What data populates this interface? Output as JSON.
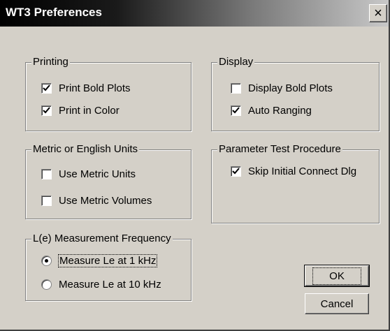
{
  "window": {
    "title": "WT3 Preferences",
    "close_glyph": "×"
  },
  "printing": {
    "legend": "Printing",
    "items": [
      {
        "label": "Print Bold Plots",
        "checked": true
      },
      {
        "label": "Print in Color",
        "checked": true
      }
    ]
  },
  "display": {
    "legend": "Display",
    "items": [
      {
        "label": "Display Bold Plots",
        "checked": false
      },
      {
        "label": "Auto Ranging",
        "checked": true
      }
    ]
  },
  "units": {
    "legend": "Metric or English Units",
    "items": [
      {
        "label": "Use Metric Units",
        "checked": false
      },
      {
        "label": "Use Metric Volumes",
        "checked": false
      }
    ]
  },
  "param_test": {
    "legend": "Parameter Test Procedure",
    "items": [
      {
        "label": "Skip Initial Connect Dlg",
        "checked": true
      }
    ]
  },
  "le_freq": {
    "legend": "L(e) Measurement Frequency",
    "options": [
      {
        "label": "Measure Le at 1 kHz",
        "selected": true
      },
      {
        "label": "Measure Le at 10 kHz",
        "selected": false
      }
    ]
  },
  "buttons": {
    "ok": "OK",
    "cancel": "Cancel"
  }
}
